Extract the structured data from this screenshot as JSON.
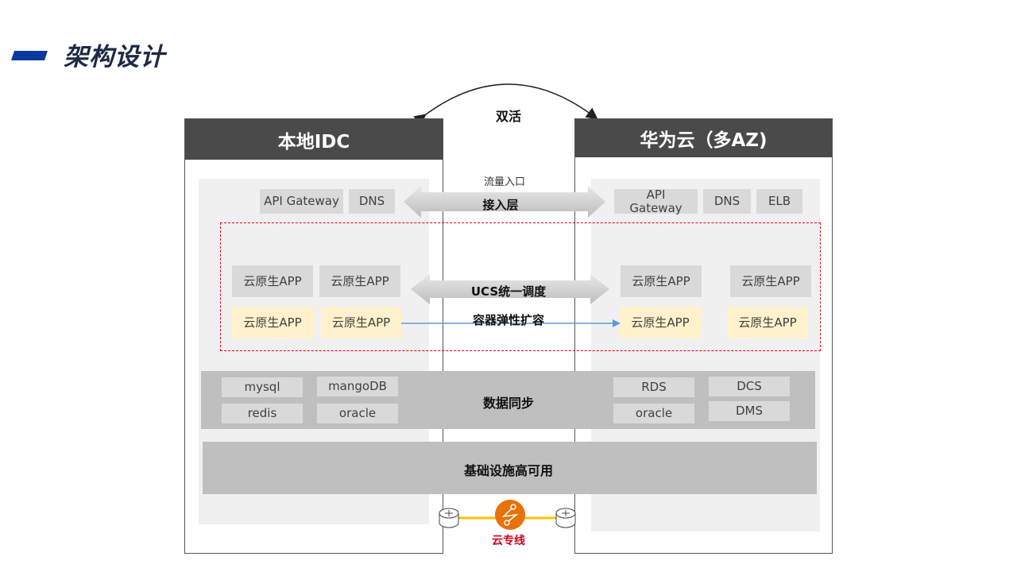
{
  "page": {
    "title": "架构设计"
  },
  "diagram": {
    "active_active_label": "双活",
    "left": {
      "title": "本地IDC",
      "access": [
        "API Gateway",
        "DNS"
      ],
      "apps_top": [
        "云原生APP",
        "云原生APP"
      ],
      "apps_bottom": [
        "云原生APP",
        "云原生APP"
      ],
      "databases": [
        "mysql",
        "mangoDB",
        "redis",
        "oracle"
      ]
    },
    "right": {
      "title": "华为云（多AZ)",
      "access": [
        "API Gateway",
        "DNS",
        "ELB"
      ],
      "apps_top": [
        "云原生APP",
        "云原生APP"
      ],
      "apps_bottom": [
        "云原生APP",
        "云原生APP"
      ],
      "databases": [
        "RDS",
        "DCS",
        "oracle",
        "DMS"
      ]
    },
    "middle": {
      "traffic_entry": "流量入口",
      "access_layer": "接入层",
      "ucs": "UCS统一调度",
      "scaling": "容器弹性扩容",
      "data_sync": "数据同步",
      "infra_ha": "基础设施高可用",
      "dedicated_line": "云专线"
    },
    "colors": {
      "header": "#4a4a4a",
      "dashed_border": "#e60012",
      "app_yellow": "#fff2cc",
      "dedicated_line": "#ffc000",
      "dedicated_icon": "#e8710a",
      "dedicated_label": "#d0021b",
      "scaling_arrow": "#5b9bd5",
      "title_accent": "#0a3a9e"
    }
  }
}
